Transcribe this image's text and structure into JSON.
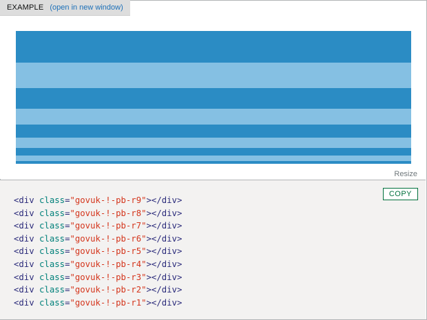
{
  "tabbar": {
    "label": "EXAMPLE",
    "link": "(open in new window)"
  },
  "preview": {
    "stripes": [
      {
        "shade": "dark",
        "height": 46
      },
      {
        "shade": "light",
        "height": 37
      },
      {
        "shade": "dark",
        "height": 30
      },
      {
        "shade": "light",
        "height": 23
      },
      {
        "shade": "dark",
        "height": 19
      },
      {
        "shade": "light",
        "height": 15
      },
      {
        "shade": "dark",
        "height": 11
      },
      {
        "shade": "light",
        "height": 8
      },
      {
        "shade": "dark",
        "height": 4
      }
    ],
    "resize_label": "Resize"
  },
  "code_panel": {
    "copy_label": "COPY",
    "lines": [
      {
        "open": "<div",
        "attr": "class",
        "eq": "=",
        "value": "\"govuk-!-pb-r9\"",
        "close": "></div>"
      },
      {
        "open": "<div",
        "attr": "class",
        "eq": "=",
        "value": "\"govuk-!-pb-r8\"",
        "close": "></div>"
      },
      {
        "open": "<div",
        "attr": "class",
        "eq": "=",
        "value": "\"govuk-!-pb-r7\"",
        "close": "></div>"
      },
      {
        "open": "<div",
        "attr": "class",
        "eq": "=",
        "value": "\"govuk-!-pb-r6\"",
        "close": "></div>"
      },
      {
        "open": "<div",
        "attr": "class",
        "eq": "=",
        "value": "\"govuk-!-pb-r5\"",
        "close": "></div>"
      },
      {
        "open": "<div",
        "attr": "class",
        "eq": "=",
        "value": "\"govuk-!-pb-r4\"",
        "close": "></div>"
      },
      {
        "open": "<div",
        "attr": "class",
        "eq": "=",
        "value": "\"govuk-!-pb-r3\"",
        "close": "></div>"
      },
      {
        "open": "<div",
        "attr": "class",
        "eq": "=",
        "value": "\"govuk-!-pb-r2\"",
        "close": "></div>"
      },
      {
        "open": "<div",
        "attr": "class",
        "eq": "=",
        "value": "\"govuk-!-pb-r1\"",
        "close": "></div>"
      }
    ]
  },
  "colors": {
    "stripe_dark": "#2b8cc4",
    "stripe_light": "#85c0e3",
    "copy_accent": "#00703c",
    "link": "#1d70b8"
  }
}
